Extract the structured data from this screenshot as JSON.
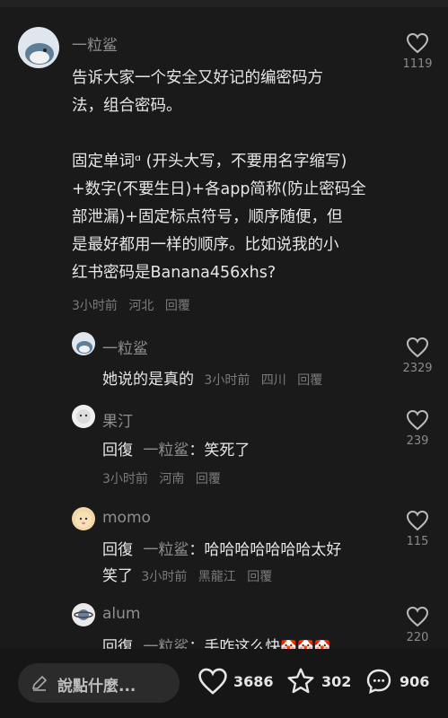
{
  "comments": [
    {
      "username": "一粒鲨",
      "lines": [
        "告诉大家一个安全又好记的编密码方",
        "法，组合密码。",
        "",
        "固定单词ᵅ (开头大写，不要用名字缩写)",
        "+数字(不要生日)+各app简称(防止密码全",
        "部泄漏)+固定标点符号，顺序随便，但",
        "是最好都用一样的顺序。比如说我的小",
        "红书密码是Banana456xhs?"
      ],
      "time": "3小时前",
      "location": "河北",
      "reply_label": "回覆",
      "likes": "1119"
    }
  ],
  "replies": [
    {
      "username": "一粒鲨",
      "text": "她说的是真的",
      "time": "3小时前",
      "location": "四川",
      "reply_label": "回覆",
      "likes": "2329"
    },
    {
      "username": "果汀",
      "prefix": "回復",
      "reply_to": "一粒鲨",
      "text": "：笑死了",
      "time": "3小时前",
      "location": "河南",
      "reply_label": "回覆",
      "likes": "239"
    },
    {
      "username": "momo",
      "prefix": "回復",
      "reply_to": "一粒鲨",
      "text": "：哈哈哈哈哈哈哈太好",
      "text2": "笑了",
      "time": "3小时前",
      "location": "黑龍江",
      "reply_label": "回覆",
      "likes": "115"
    },
    {
      "username": "alum",
      "prefix": "回復",
      "reply_to": "一粒鲨",
      "text": "：手咋这么快",
      "emojis": "🤡🤡🤡",
      "likes": "220"
    }
  ],
  "bottom": {
    "placeholder": "說點什麼...",
    "likes": "3686",
    "stars": "302",
    "comments": "906"
  }
}
